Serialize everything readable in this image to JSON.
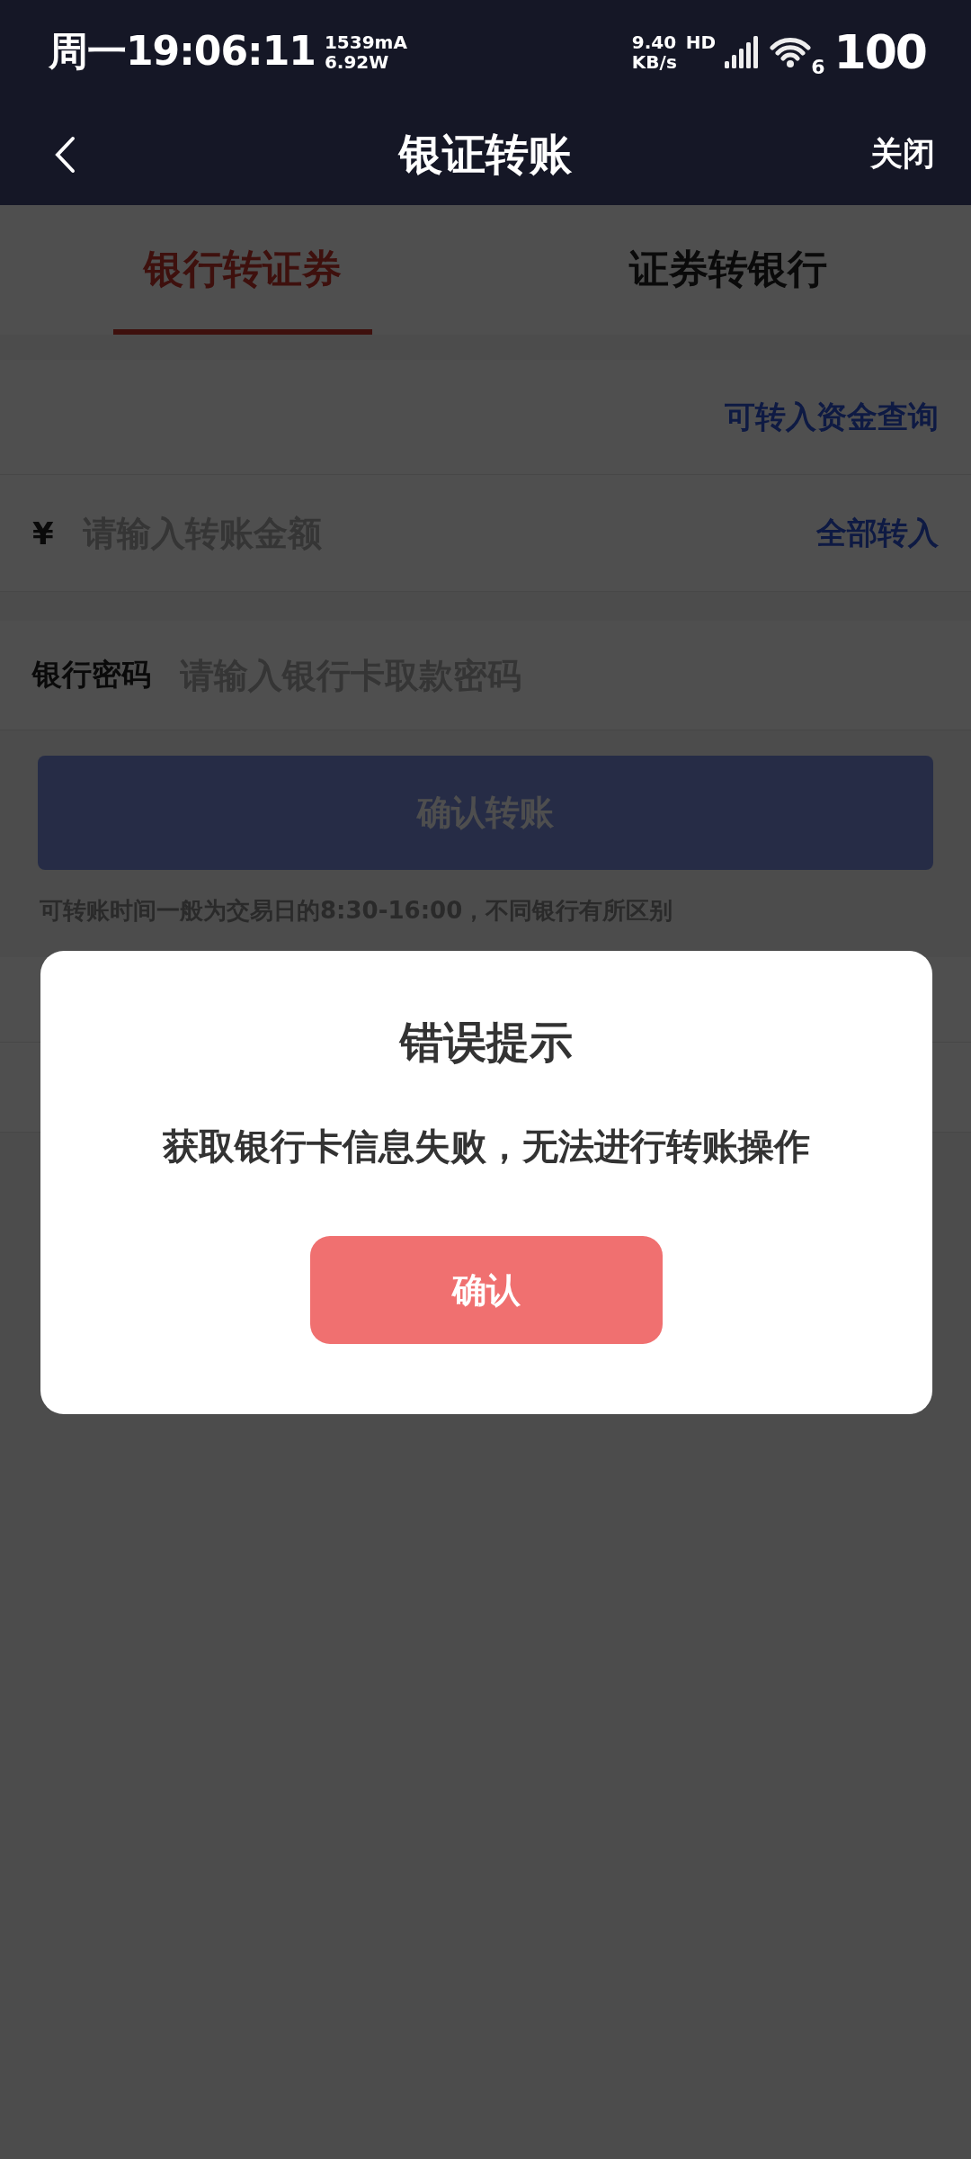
{
  "status_bar": {
    "day_time": "周一19:06:11",
    "current": "1539mA",
    "power": "6.92W",
    "net_speed": "9.40",
    "net_unit": "KB/s",
    "hd": "HD",
    "wifi_gen": "6",
    "battery": "100"
  },
  "nav": {
    "title": "银证转账",
    "close": "关闭"
  },
  "tabs": [
    {
      "label": "银行转证券",
      "selected": true
    },
    {
      "label": "证券转银行",
      "selected": false
    }
  ],
  "query_link": "可转入资金查询",
  "amount": {
    "currency": "¥",
    "placeholder": "请输入转账金额",
    "all": "全部转入"
  },
  "password": {
    "label": "银行密码",
    "placeholder": "请输入银行卡取款密码"
  },
  "submit": "确认转账",
  "hint": "可转账时间一般为交易日的8:30-16:00，不同银行有所区别",
  "dialog": {
    "title": "错误提示",
    "message": "获取银行卡信息失败，无法进行转账操作",
    "button": "确认"
  }
}
